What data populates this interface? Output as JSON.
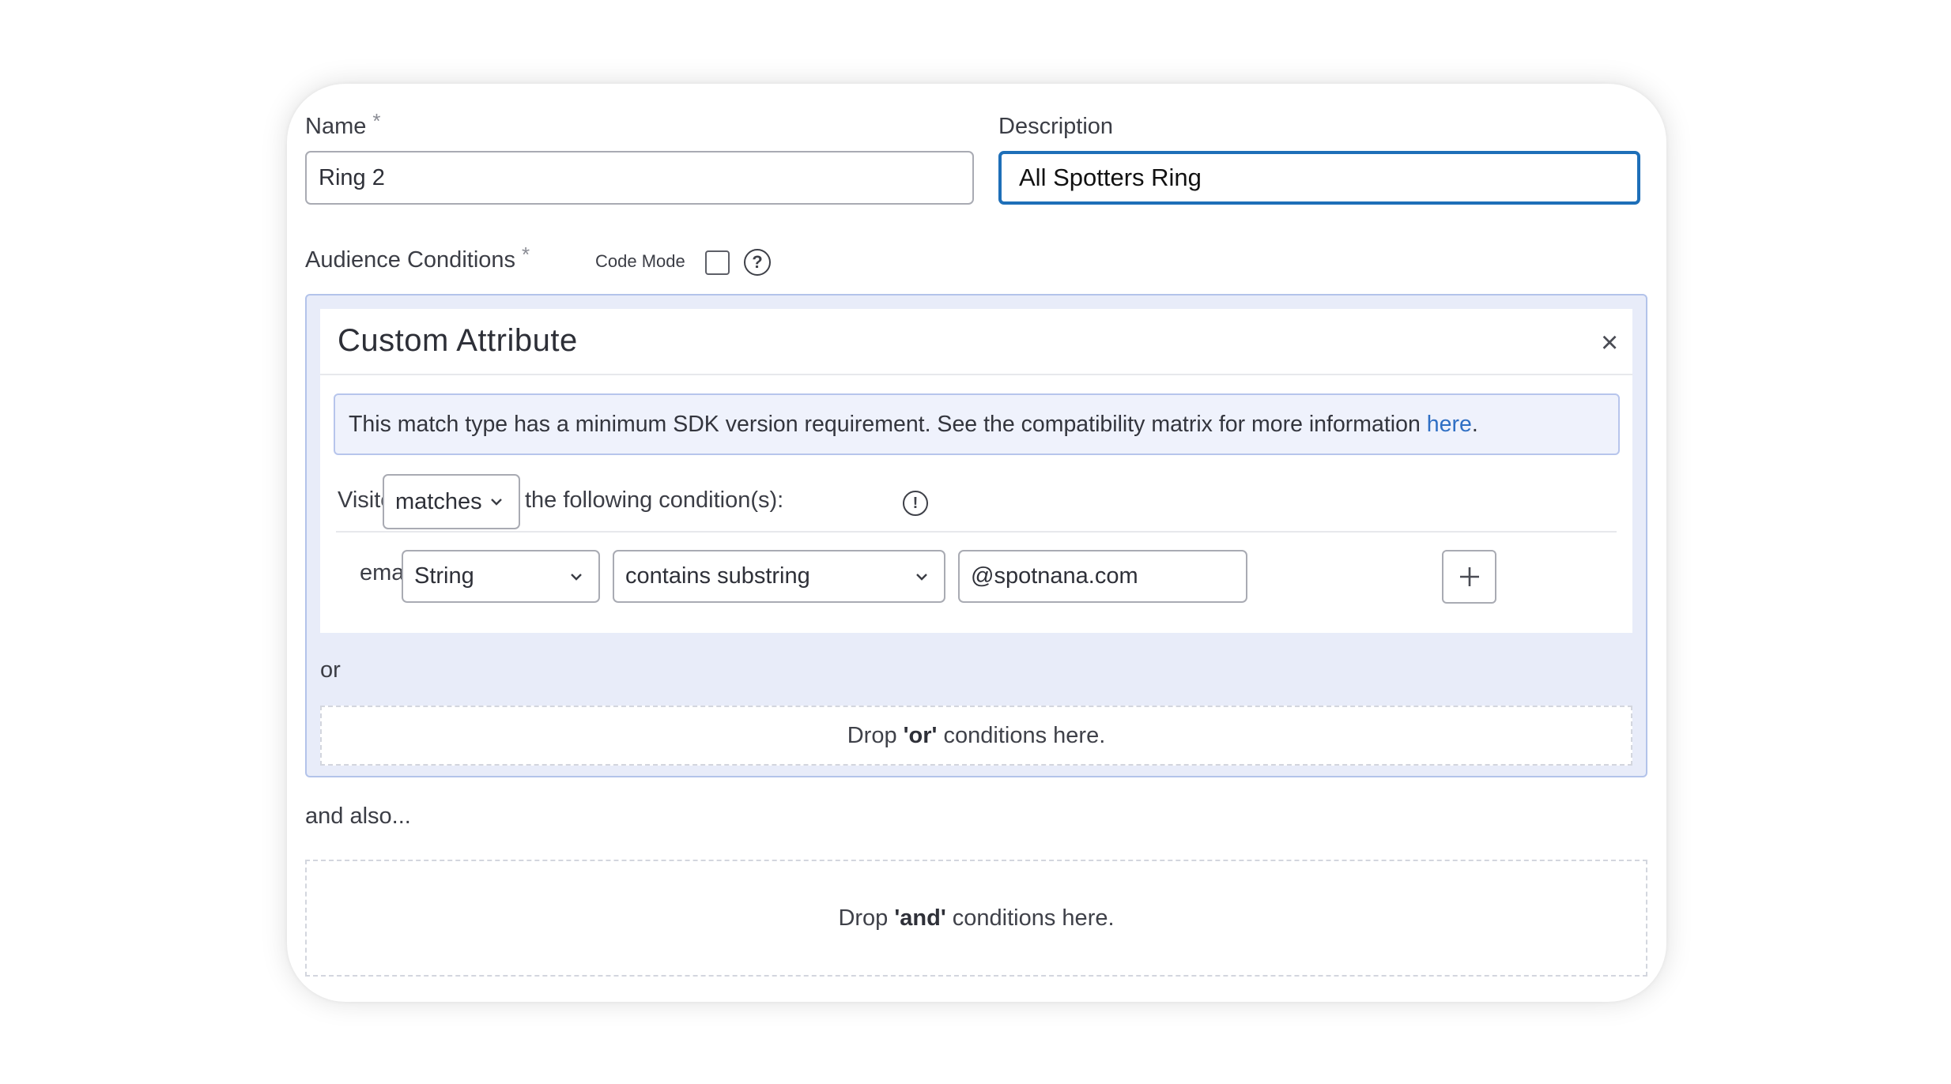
{
  "form": {
    "name_label": "Name",
    "name_required_mark": "*",
    "name_value": "Ring 2",
    "description_label": "Description",
    "description_value": "All Spotters Ring",
    "audience_label": "Audience Conditions",
    "audience_required_mark": "*",
    "code_mode_label": "Code Mode",
    "help_icon_glyph": "?"
  },
  "condition_card": {
    "title": "Custom Attribute",
    "close_glyph": "×",
    "notice_text": "This match type has a minimum SDK version requirement. See the compatibility matrix for more information ",
    "notice_link": "here",
    "notice_end": ".",
    "visitor_label": "Visitor",
    "match_select": "matches",
    "following_text": "the following condition(s):",
    "info_icon_glyph": "!",
    "attribute_name": "email",
    "type_select": "String",
    "operator_select": "contains substring",
    "value_input": "@spotnana.com",
    "add_glyph": "+"
  },
  "or_label": "or",
  "or_drop": {
    "prefix": "Drop ",
    "keyword": "'or'",
    "suffix": " conditions here."
  },
  "and_also_label": "and also...",
  "and_drop": {
    "prefix": "Drop ",
    "keyword": "'and'",
    "suffix": " conditions here."
  },
  "icons": [
    "help-icon",
    "close-icon",
    "chevron-down-icon",
    "info-icon",
    "plus-icon"
  ],
  "colors": {
    "focus_border": "#1e6fb8",
    "link": "#2f6fc4",
    "panel_bg": "#e8ecf9",
    "panel_border": "#b3c3ea"
  }
}
